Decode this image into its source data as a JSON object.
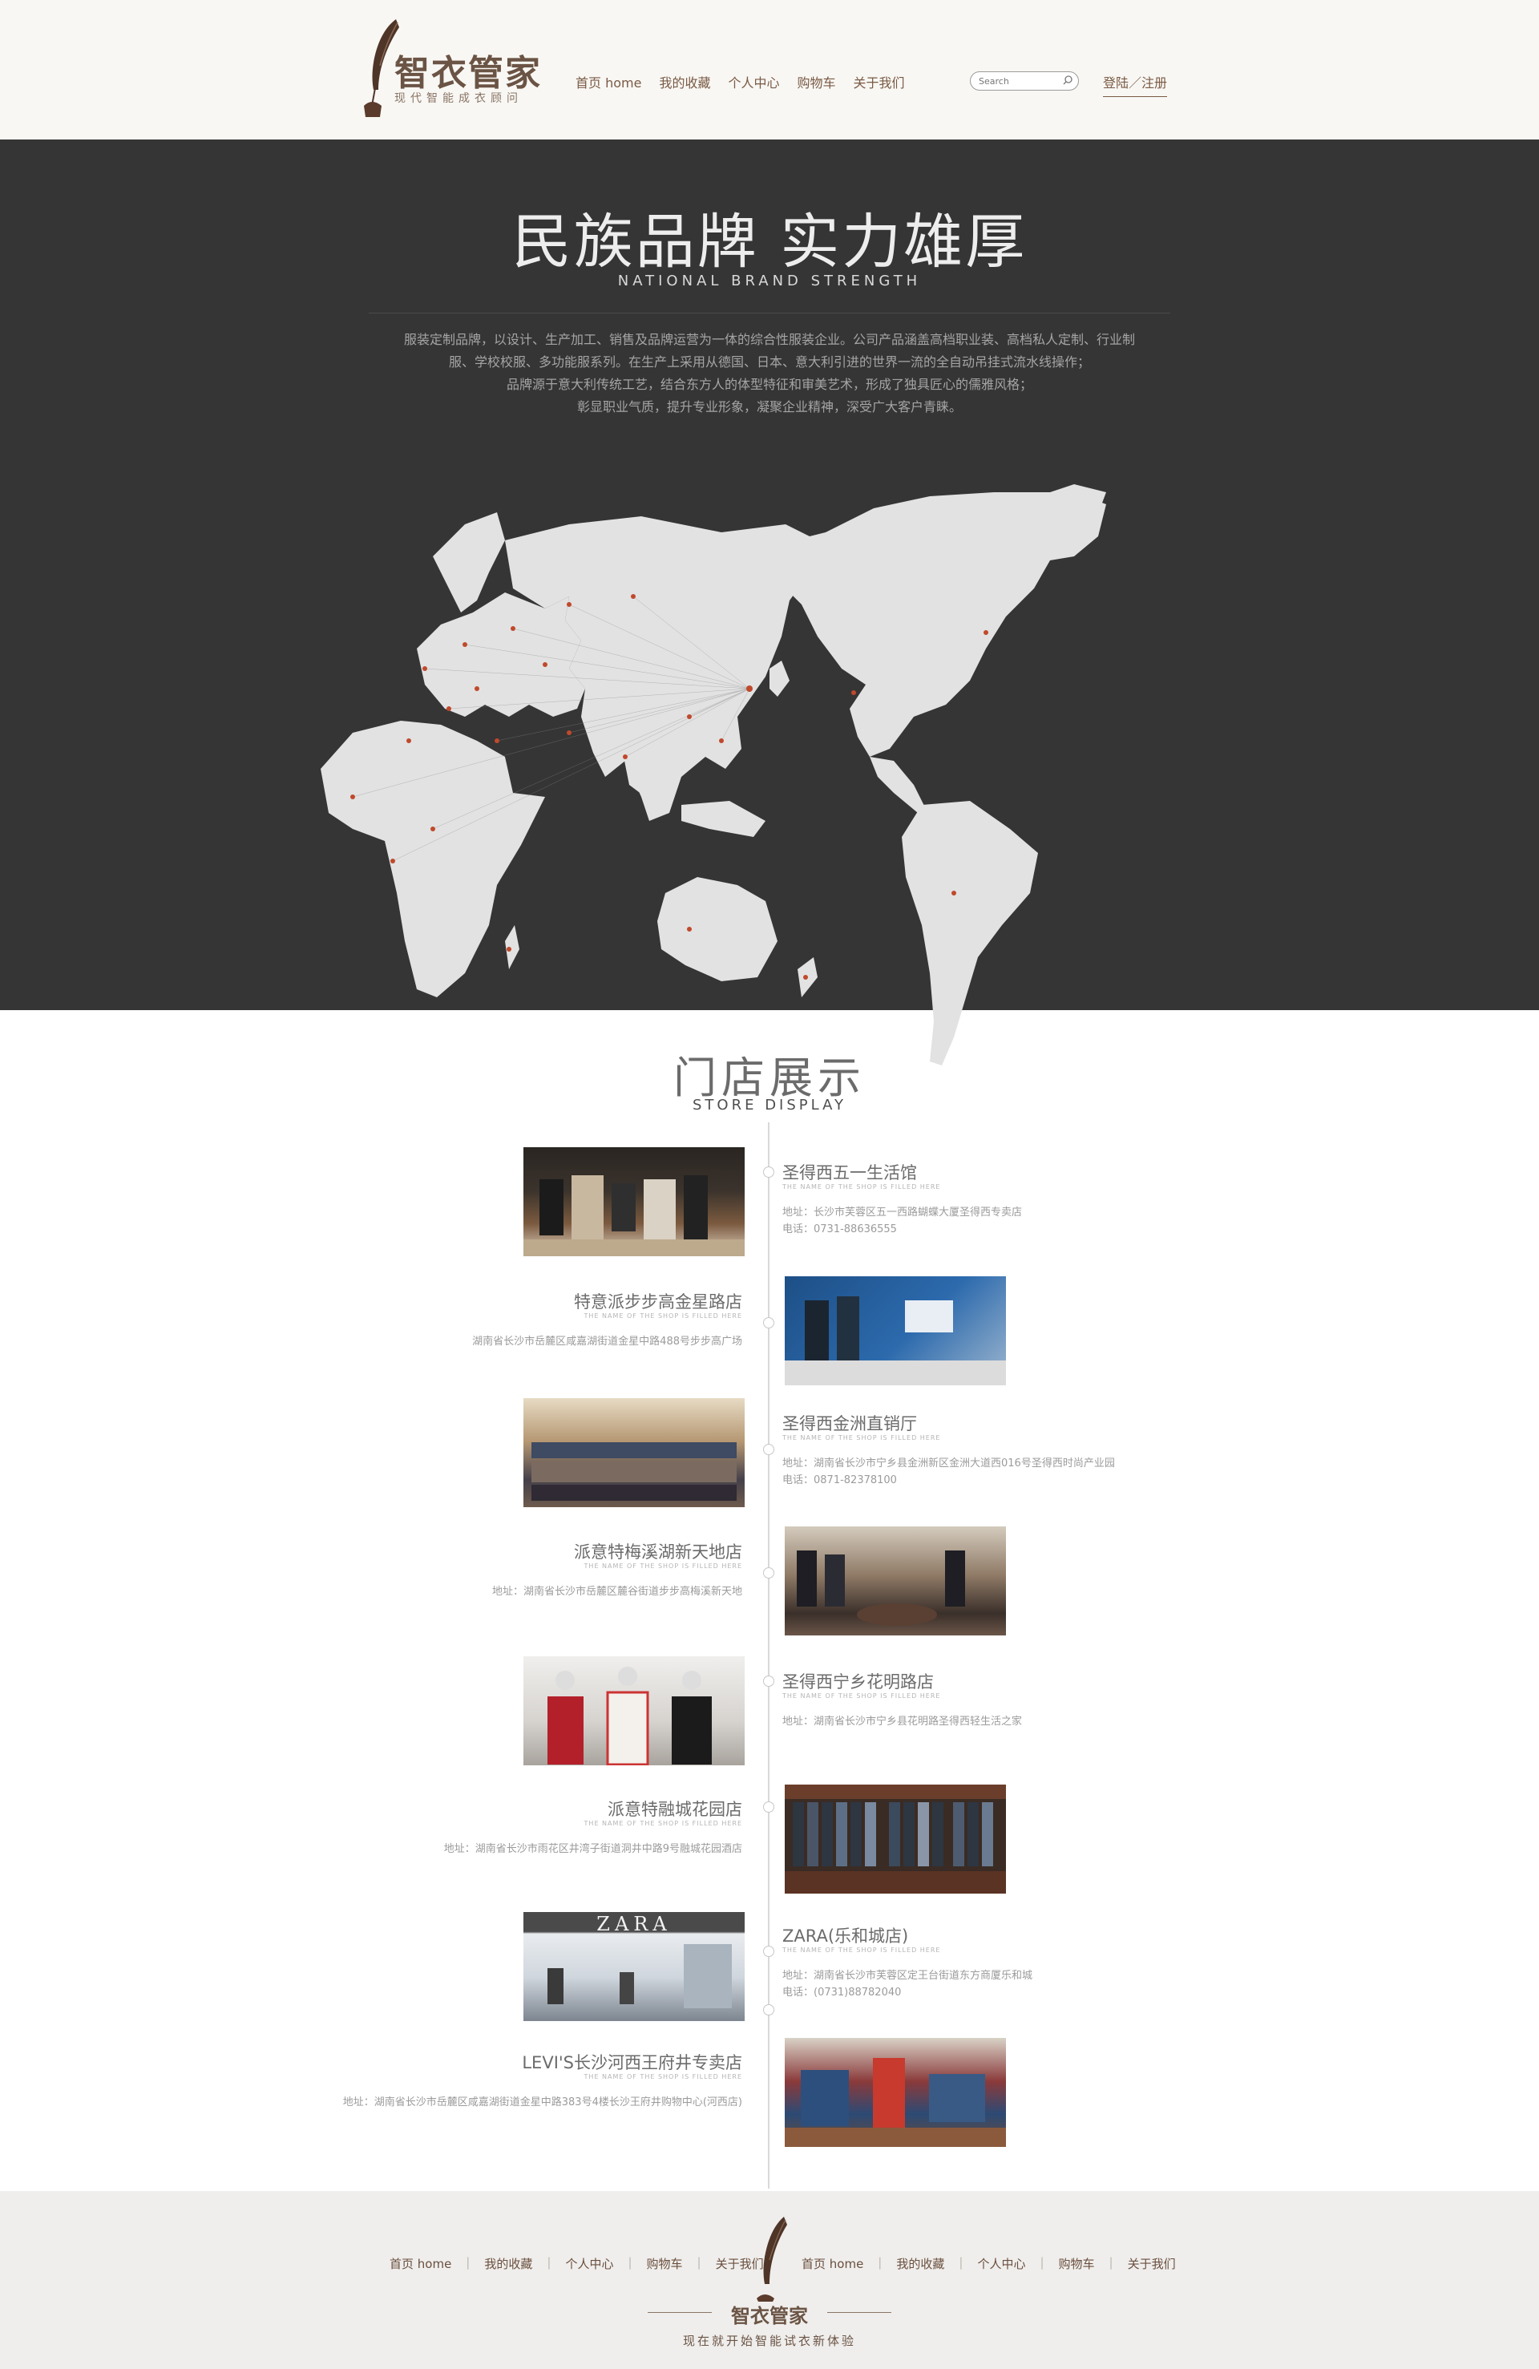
{
  "header": {
    "logo_title": "智衣管家",
    "logo_sub": "现代智能成衣顾问",
    "nav": [
      "首页 home",
      "我的收藏",
      "个人中心",
      "购物车",
      "关于我们"
    ],
    "search_placeholder": "Search",
    "login": "登陆／注册"
  },
  "brand": {
    "title": "民族品牌 实力雄厚",
    "subtitle": "NATIONAL BRAND STRENGTH",
    "desc": [
      "服装定制品牌，以设计、生产加工、销售及品牌运营为一体的综合性服装企业。公司产品涵盖高档职业装、高档私人定制、行业制",
      "服、学校校服、多功能服系列。在生产上采用从德国、日本、意大利引进的世界一流的全自动吊挂式流水线操作；",
      "品牌源于意大利传统工艺，结合东方人的体型特征和审美艺术，形成了独具匠心的儒雅风格；",
      "彰显职业气质，提升专业形象，凝聚企业精神，深受广大客户青睐。"
    ]
  },
  "stores": {
    "title": "门店展示",
    "subtitle": "STORE DISPLAY",
    "name_en": "THE NAME OF THE SHOP IS FILLED HERE",
    "items": [
      {
        "name": "圣得西五一生活馆",
        "lines": [
          "地址：长沙市芙蓉区五一西路蝴蝶大厦圣得西专卖店",
          "电话：0731-88636555"
        ]
      },
      {
        "name": "特意派步步高金星路店",
        "lines": [
          "湖南省长沙市岳麓区咸嘉湖街道金星中路488号步步高广场"
        ]
      },
      {
        "name": "圣得西金洲直销厅",
        "lines": [
          "地址：湖南省长沙市宁乡县金洲新区金洲大道西016号圣得西时尚产业园",
          "电话：0871-82378100"
        ]
      },
      {
        "name": "派意特梅溪湖新天地店",
        "lines": [
          "地址：湖南省长沙市岳麓区麓谷街道步步高梅溪新天地"
        ]
      },
      {
        "name": "圣得西宁乡花明路店",
        "lines": [
          "地址：湖南省长沙市宁乡县花明路圣得西轻生活之家"
        ]
      },
      {
        "name": "派意特融城花园店",
        "lines": [
          "地址：湖南省长沙市雨花区井湾子街道洞井中路9号融城花园酒店"
        ]
      },
      {
        "name": "ZARA(乐和城店)",
        "lines": [
          "地址：湖南省长沙市芙蓉区定王台街道东方商厦乐和城",
          "电话：(0731)88782040"
        ]
      },
      {
        "name": "LEVI'S长沙河西王府井专卖店",
        "lines": [
          "地址：湖南省长沙市岳麓区咸嘉湖街道金星中路383号4楼长沙王府井购物中心(河西店)"
        ]
      }
    ],
    "zara_sign": "ZARA"
  },
  "footer": {
    "nav_left": [
      "首页 home",
      "我的收藏",
      "个人中心",
      "购物车",
      "关于我们"
    ],
    "nav_right": [
      "首页 home",
      "我的收藏",
      "个人中心",
      "购物车",
      "关于我们"
    ],
    "logo_title": "智衣管家",
    "slogan": "现在就开始智能试衣新体验"
  },
  "colors": {
    "brand_bg": "#353535",
    "accent_brown": "#6b5445",
    "map_land": "#e2e2e2",
    "map_marker": "#c0492c"
  }
}
